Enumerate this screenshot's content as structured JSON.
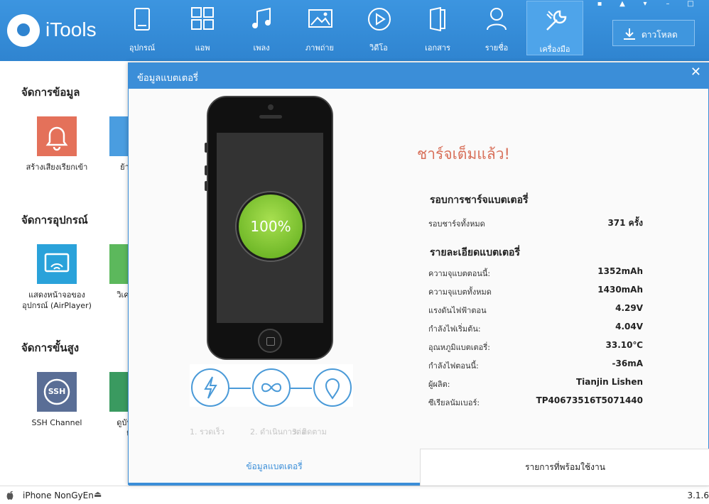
{
  "app": {
    "name": "iTools"
  },
  "nav": [
    {
      "label": "อุปกรณ์",
      "icon": "device-icon"
    },
    {
      "label": "แอพ",
      "icon": "apps-icon"
    },
    {
      "label": "เพลง",
      "icon": "music-icon"
    },
    {
      "label": "ภาพถ่าย",
      "icon": "photo-icon"
    },
    {
      "label": "วิดีโอ",
      "icon": "video-icon"
    },
    {
      "label": "เอกสาร",
      "icon": "document-icon"
    },
    {
      "label": "รายชื่อ",
      "icon": "contacts-icon"
    },
    {
      "label": "เครื่องมือ",
      "icon": "tools-icon"
    }
  ],
  "download_label": "ดาวโหลด",
  "sidebar": {
    "sections": [
      {
        "title": "จัดการข้อมูล"
      },
      {
        "title": "จัดการอุปกรณ์"
      },
      {
        "title": "จัดการขั้นสูง"
      }
    ],
    "tools": [
      {
        "label": "สร้างเสียงเรียกเข้า",
        "icon": "bell-icon"
      },
      {
        "label": "ย้ายอ",
        "icon": "tablet-icon"
      },
      {
        "label": "แสดงหน้าจอของ",
        "label2": "อุปกรณ์ (AirPlayer)",
        "icon": "airplay-icon"
      },
      {
        "label": "วิเคราะ",
        "icon": "analyze-icon"
      },
      {
        "label": "SSH Channel",
        "icon": "ssh-icon",
        "badge": "SSH"
      },
      {
        "label": "ดูบันทึก",
        "label2": "ti",
        "icon": "log-icon"
      }
    ]
  },
  "status": {
    "device": "iPhone NonGyEn",
    "version": "3.1.6"
  },
  "modal": {
    "title": "ข้อมูลแบตเตอรี่",
    "close": "✕",
    "battery_percent_text": "100%",
    "charged_text": "ชาร์จเต็มแล้ว!",
    "steps": [
      "1. รวดเร็ว",
      "2. ดำเนินการต่อ",
      "3. ติดตาม"
    ],
    "cycle_group": {
      "title": "รอบการชาร์จแบตเตอรี่",
      "rows": [
        {
          "key": "รอบชาร์จทั้งหมด",
          "value": "371  ครั้ง"
        }
      ]
    },
    "detail_group": {
      "title": "รายละเอียดแบตเตอรี่",
      "rows": [
        {
          "key": "ความจุแบตตอนนี้:",
          "value": "1352mAh"
        },
        {
          "key": "ความจุแบตทั้งหมด",
          "value": "1430mAh"
        },
        {
          "key": "แรงดันไฟฟ้าตอน",
          "value": "4.29V"
        },
        {
          "key": "กำลังไฟเริ่มต้น:",
          "value": "4.04V"
        },
        {
          "key": "อุณหภูมิแบตเตอรี่:",
          "value": "33.10℃"
        },
        {
          "key": "กำลังไฟตอนนี้:",
          "value": "-36mA"
        },
        {
          "key": "ผู้ผลิต:",
          "value": "Tianjin Lishen"
        },
        {
          "key": "ซีเรียลนัมเบอร์:",
          "value": "TP40673516T5071440"
        }
      ]
    },
    "tabs": {
      "left": "ข้อมูลแบตเตอรี่",
      "right": "รายการที่พร้อมใช้งาน"
    }
  }
}
